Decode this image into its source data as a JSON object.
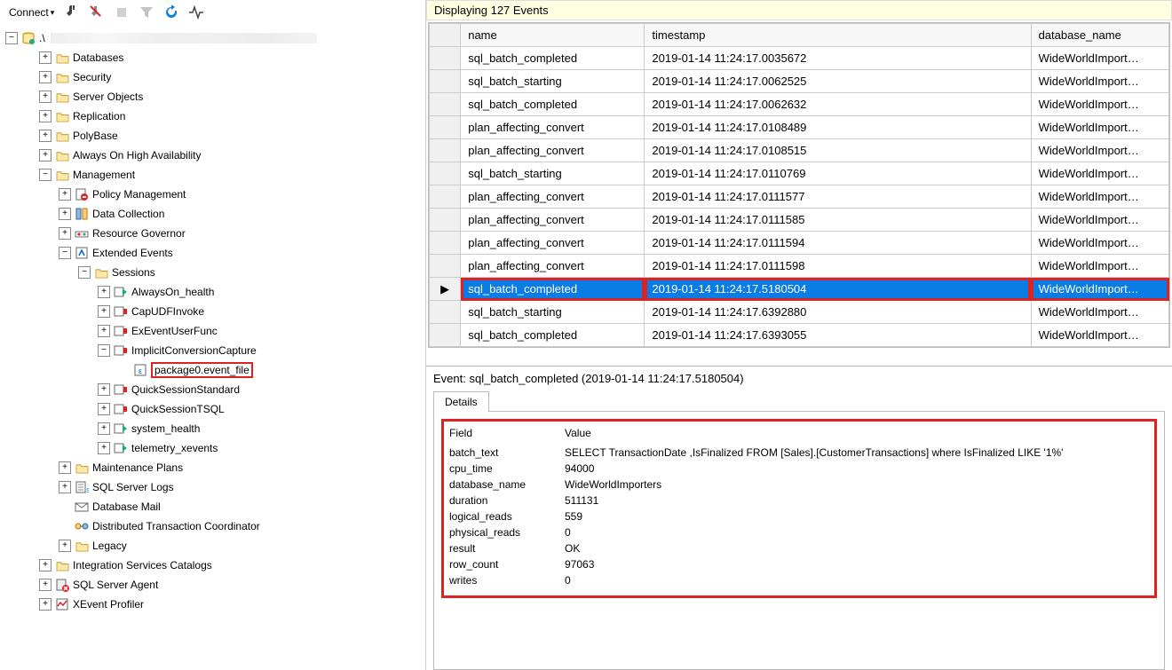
{
  "toolbar": {
    "connect_label": "Connect",
    "icons": [
      "plug",
      "xplug",
      "sep",
      "filter",
      "refresh",
      "pulse"
    ]
  },
  "tree": {
    "root": {
      "label": ".\\",
      "type": "server"
    },
    "nodes": [
      {
        "depth": 1,
        "exp": "+",
        "icon": "folder",
        "label": "Databases"
      },
      {
        "depth": 1,
        "exp": "+",
        "icon": "folder",
        "label": "Security"
      },
      {
        "depth": 1,
        "exp": "+",
        "icon": "folder",
        "label": "Server Objects"
      },
      {
        "depth": 1,
        "exp": "+",
        "icon": "folder",
        "label": "Replication"
      },
      {
        "depth": 1,
        "exp": "+",
        "icon": "folder",
        "label": "PolyBase"
      },
      {
        "depth": 1,
        "exp": "+",
        "icon": "folder",
        "label": "Always On High Availability"
      },
      {
        "depth": 1,
        "exp": "-",
        "icon": "folder",
        "label": "Management"
      },
      {
        "depth": 2,
        "exp": "+",
        "icon": "policy",
        "label": "Policy Management"
      },
      {
        "depth": 2,
        "exp": "+",
        "icon": "datacol",
        "label": "Data Collection"
      },
      {
        "depth": 2,
        "exp": "+",
        "icon": "resgov",
        "label": "Resource Governor"
      },
      {
        "depth": 2,
        "exp": "-",
        "icon": "xe",
        "label": "Extended Events"
      },
      {
        "depth": 3,
        "exp": "-",
        "icon": "folder",
        "label": "Sessions"
      },
      {
        "depth": 4,
        "exp": "+",
        "icon": "xesess_on",
        "label": "AlwaysOn_health"
      },
      {
        "depth": 4,
        "exp": "+",
        "icon": "xesess_off",
        "label": "CapUDFInvoke"
      },
      {
        "depth": 4,
        "exp": "+",
        "icon": "xesess_off",
        "label": "ExEventUserFunc"
      },
      {
        "depth": 4,
        "exp": "-",
        "icon": "xesess_off",
        "label": "ImplicitConversionCapture"
      },
      {
        "depth": 5,
        "exp": "",
        "icon": "xetarget",
        "label": "package0.event_file",
        "highlight": true
      },
      {
        "depth": 4,
        "exp": "+",
        "icon": "xesess_off",
        "label": "QuickSessionStandard"
      },
      {
        "depth": 4,
        "exp": "+",
        "icon": "xesess_off",
        "label": "QuickSessionTSQL"
      },
      {
        "depth": 4,
        "exp": "+",
        "icon": "xesess_on",
        "label": "system_health"
      },
      {
        "depth": 4,
        "exp": "+",
        "icon": "xesess_on",
        "label": "telemetry_xevents"
      },
      {
        "depth": 2,
        "exp": "+",
        "icon": "folder",
        "label": "Maintenance Plans"
      },
      {
        "depth": 2,
        "exp": "+",
        "icon": "sqllogs",
        "label": "SQL Server Logs"
      },
      {
        "depth": 2,
        "exp": "",
        "icon": "dbmail",
        "label": "Database Mail"
      },
      {
        "depth": 2,
        "exp": "",
        "icon": "dtc",
        "label": "Distributed Transaction Coordinator"
      },
      {
        "depth": 2,
        "exp": "+",
        "icon": "folder",
        "label": "Legacy"
      },
      {
        "depth": 1,
        "exp": "+",
        "icon": "folder",
        "label": "Integration Services Catalogs"
      },
      {
        "depth": 1,
        "exp": "+",
        "icon": "agentoff",
        "label": "SQL Server Agent"
      },
      {
        "depth": 1,
        "exp": "+",
        "icon": "xeprof",
        "label": "XEvent Profiler"
      }
    ]
  },
  "eventsHeader": {
    "text": "Displaying 127 Events"
  },
  "grid": {
    "columns": [
      "name",
      "timestamp",
      "database_name"
    ],
    "rows": [
      {
        "name": "sql_batch_completed",
        "timestamp": "2019-01-14 11:24:17.0035672",
        "db": "WideWorldImport…"
      },
      {
        "name": "sql_batch_starting",
        "timestamp": "2019-01-14 11:24:17.0062525",
        "db": "WideWorldImport…"
      },
      {
        "name": "sql_batch_completed",
        "timestamp": "2019-01-14 11:24:17.0062632",
        "db": "WideWorldImport…"
      },
      {
        "name": "plan_affecting_convert",
        "timestamp": "2019-01-14 11:24:17.0108489",
        "db": "WideWorldImport…"
      },
      {
        "name": "plan_affecting_convert",
        "timestamp": "2019-01-14 11:24:17.0108515",
        "db": "WideWorldImport…"
      },
      {
        "name": "sql_batch_starting",
        "timestamp": "2019-01-14 11:24:17.0110769",
        "db": "WideWorldImport…"
      },
      {
        "name": "plan_affecting_convert",
        "timestamp": "2019-01-14 11:24:17.0111577",
        "db": "WideWorldImport…"
      },
      {
        "name": "plan_affecting_convert",
        "timestamp": "2019-01-14 11:24:17.0111585",
        "db": "WideWorldImport…"
      },
      {
        "name": "plan_affecting_convert",
        "timestamp": "2019-01-14 11:24:17.0111594",
        "db": "WideWorldImport…"
      },
      {
        "name": "plan_affecting_convert",
        "timestamp": "2019-01-14 11:24:17.0111598",
        "db": "WideWorldImport…"
      },
      {
        "name": "sql_batch_completed",
        "timestamp": "2019-01-14 11:24:17.5180504",
        "db": "WideWorldImport…",
        "selected": true
      },
      {
        "name": "sql_batch_starting",
        "timestamp": "2019-01-14 11:24:17.6392880",
        "db": "WideWorldImport…"
      },
      {
        "name": "sql_batch_completed",
        "timestamp": "2019-01-14 11:24:17.6393055",
        "db": "WideWorldImport…"
      }
    ]
  },
  "detail": {
    "title": "Event: sql_batch_completed (2019-01-14 11:24:17.5180504)",
    "tab": "Details",
    "header_field": "Field",
    "header_value": "Value",
    "rows": [
      {
        "field": "batch_text",
        "value": "SELECT TransactionDate      ,IsFinalized    FROM [Sales].[CustomerTransactions]  where IsFinalized  LIKE '1%'"
      },
      {
        "field": "cpu_time",
        "value": "94000"
      },
      {
        "field": "database_name",
        "value": "WideWorldImporters"
      },
      {
        "field": "duration",
        "value": "511131"
      },
      {
        "field": "logical_reads",
        "value": "559"
      },
      {
        "field": "physical_reads",
        "value": "0"
      },
      {
        "field": "result",
        "value": "OK"
      },
      {
        "field": "row_count",
        "value": "97063"
      },
      {
        "field": "writes",
        "value": "0"
      }
    ]
  }
}
